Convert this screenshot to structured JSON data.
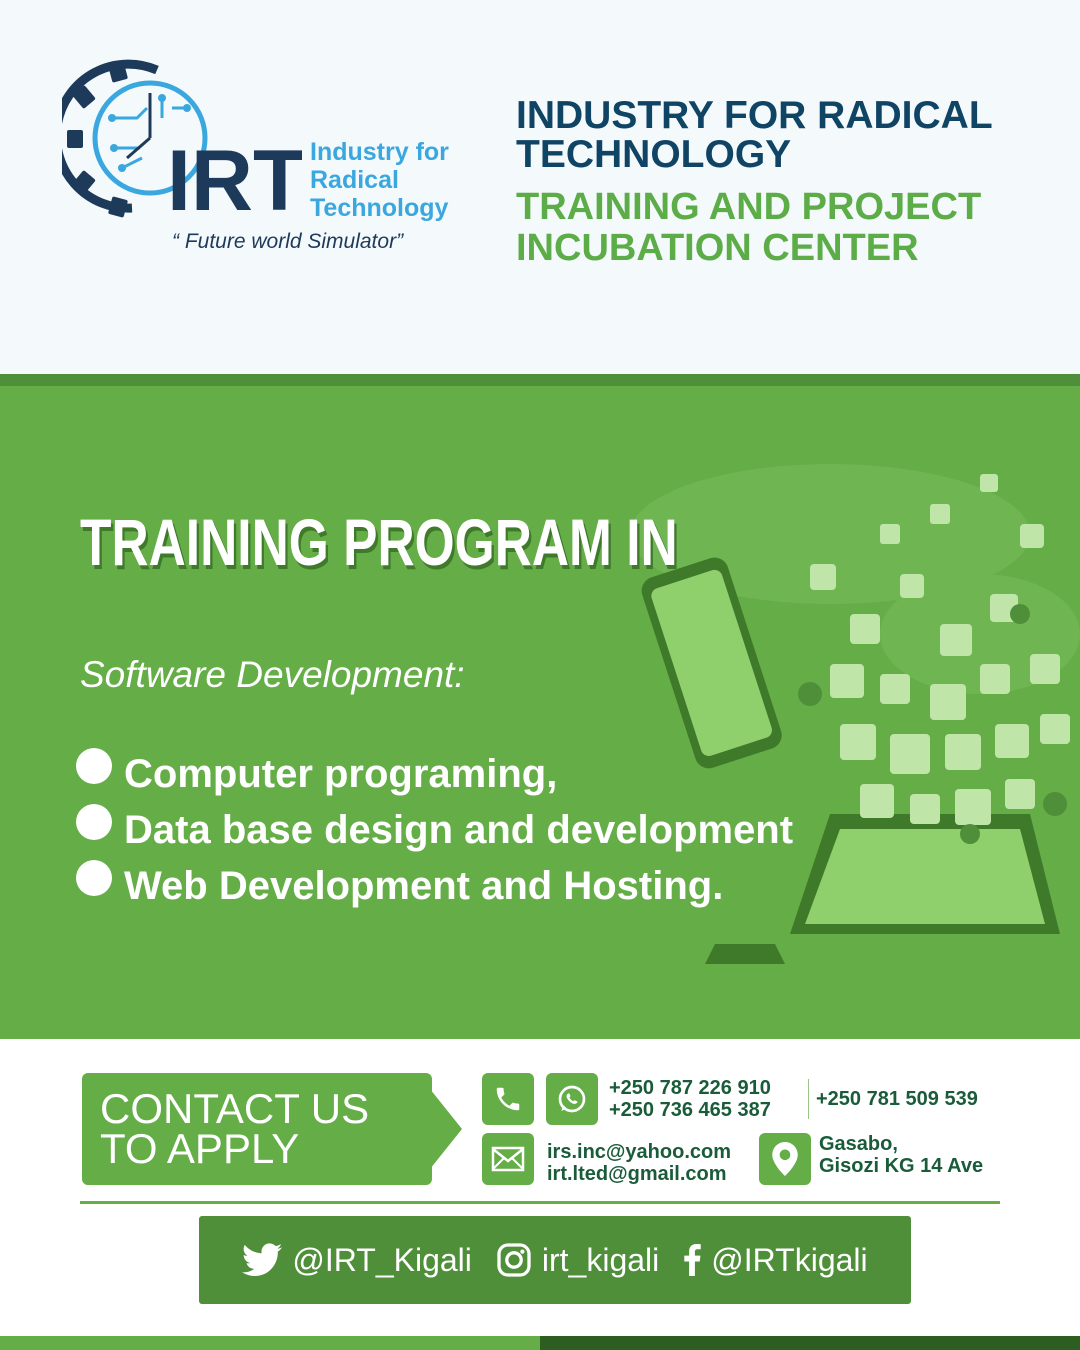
{
  "brand": {
    "logo_mark": "IRT",
    "logo_name_lines": [
      "Industry for",
      "Radical",
      "Technology"
    ],
    "tagline": "“ Future world Simulator”",
    "colors": {
      "primary_green": "#64ad47",
      "dark_green": "#4f8f39",
      "navy": "#0f4465",
      "light_blue": "#3aa7df"
    }
  },
  "header": {
    "title": "INDUSTRY FOR RADICAL TECHNOLOGY",
    "subtitle": "TRAINING AND PROJECT INCUBATION CENTER"
  },
  "program": {
    "heading": "TRAINING PROGRAM IN",
    "subheading": "Software Development:",
    "courses": [
      "Computer programing,",
      "Data base design and development",
      "Web Development and Hosting."
    ]
  },
  "contact": {
    "cta_line1": "CONTACT US",
    "cta_line2": "TO APPLY",
    "phones": [
      "+250 787 226 910",
      "+250 736 465 387",
      "+250 781 509 539"
    ],
    "emails": [
      "irs.inc@yahoo.com",
      "irt.lted@gmail.com"
    ],
    "address_lines": [
      "Gasabo,",
      "Gisozi KG 14 Ave"
    ],
    "icons": [
      "phone-icon",
      "whatsapp-icon",
      "mail-icon",
      "location-pin-icon"
    ]
  },
  "social": {
    "twitter": "@IRT_Kigali",
    "instagram": "irt_kigali",
    "facebook": "@IRTkigali",
    "icons": [
      "twitter-icon",
      "instagram-icon",
      "facebook-icon"
    ]
  }
}
